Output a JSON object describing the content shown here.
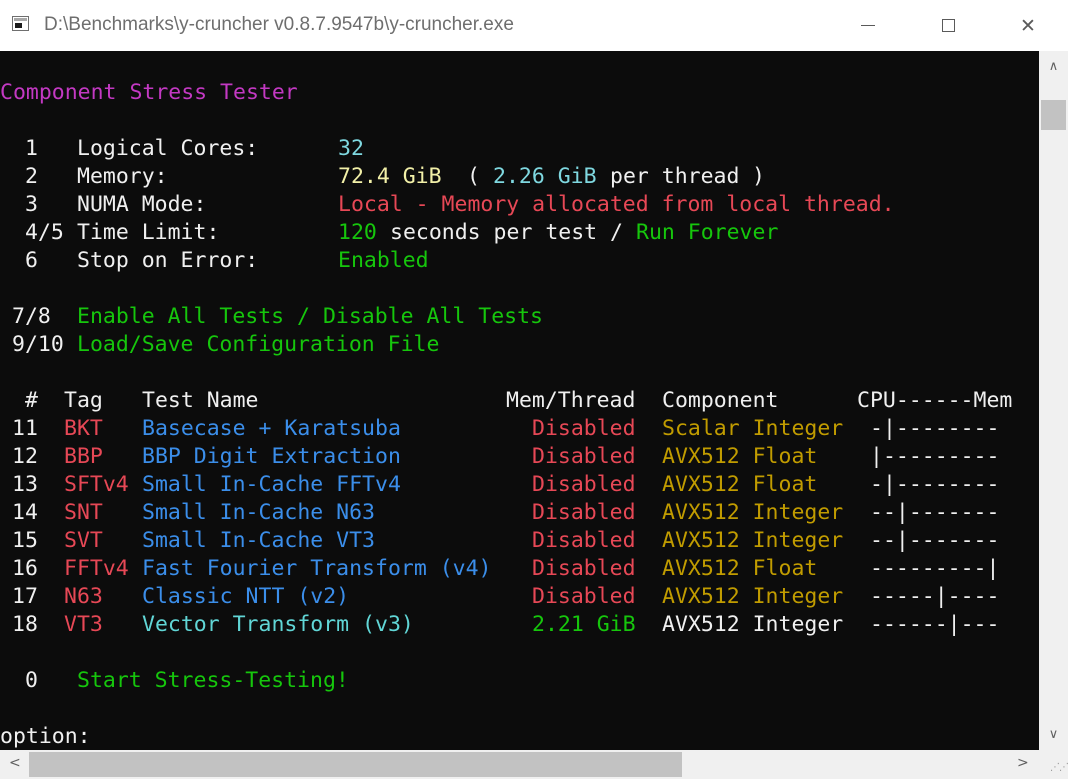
{
  "window": {
    "title": "D:\\Benchmarks\\y-cruncher v0.8.7.9547b\\y-cruncher.exe",
    "minimize_glyph": "",
    "close_glyph": "✕"
  },
  "header": {
    "title": "Component Stress Tester"
  },
  "settings": [
    {
      "key": "1",
      "label": "Logical Cores:",
      "value": "32"
    },
    {
      "key": "2",
      "label": "Memory:",
      "value_main": "72.4 GiB",
      "open": "(",
      "value_per": "2.26 GiB",
      "per_text": "per thread",
      "close": ")"
    },
    {
      "key": "3",
      "label": "NUMA Mode:",
      "value": "Local - Memory allocated from local thread."
    },
    {
      "key": "4/5",
      "label": "Time Limit:",
      "value_main": "120",
      "mid": "seconds per test /",
      "value_alt": "Run Forever"
    },
    {
      "key": "6",
      "label": "Stop on Error:",
      "value": "Enabled"
    }
  ],
  "actions": [
    {
      "key": "7/8",
      "label": "Enable All Tests / Disable All Tests"
    },
    {
      "key": "9/10",
      "label": "Load/Save Configuration File"
    }
  ],
  "table": {
    "headers": {
      "num": "#",
      "tag": "Tag",
      "name": "Test Name",
      "mem": "Mem/Thread",
      "component": "Component",
      "cpu_mem": "CPU------Mem"
    },
    "rows": [
      {
        "num": "11",
        "tag": "BKT",
        "name": "Basecase + Karatsuba",
        "mem": "Disabled",
        "component": "Scalar Integer",
        "bar": "-|--------"
      },
      {
        "num": "12",
        "tag": "BBP",
        "name": "BBP Digit Extraction",
        "mem": "Disabled",
        "component": "AVX512 Float",
        "bar": "|---------"
      },
      {
        "num": "13",
        "tag": "SFTv4",
        "name": "Small In-Cache FFTv4",
        "mem": "Disabled",
        "component": "AVX512 Float",
        "bar": "-|--------"
      },
      {
        "num": "14",
        "tag": "SNT",
        "name": "Small In-Cache N63",
        "mem": "Disabled",
        "component": "AVX512 Integer",
        "bar": "--|-------"
      },
      {
        "num": "15",
        "tag": "SVT",
        "name": "Small In-Cache VT3",
        "mem": "Disabled",
        "component": "AVX512 Integer",
        "bar": "--|-------"
      },
      {
        "num": "16",
        "tag": "FFTv4",
        "name": "Fast Fourier Transform (v4)",
        "mem": "Disabled",
        "component": "AVX512 Float",
        "bar": "---------|"
      },
      {
        "num": "17",
        "tag": "N63",
        "name": "Classic NTT (v2)",
        "mem": "Disabled",
        "component": "AVX512 Integer",
        "bar": "-----|----"
      },
      {
        "num": "18",
        "tag": "VT3",
        "name": "Vector Transform (v3)",
        "mem": "2.21 GiB",
        "component": "AVX512 Integer",
        "bar": "------|---"
      }
    ]
  },
  "start": {
    "key": "0",
    "label": "Start Stress-Testing!"
  },
  "prompt": "option:",
  "colors": {
    "title_magenta": "#c339c3",
    "value_cyan": "#7fd8e0",
    "value_yellow": "#f2f0a8",
    "error_red": "#e74856",
    "ok_green": "#16c60c",
    "name_blue": "#3b8eea",
    "component_gold": "#c19c00"
  }
}
